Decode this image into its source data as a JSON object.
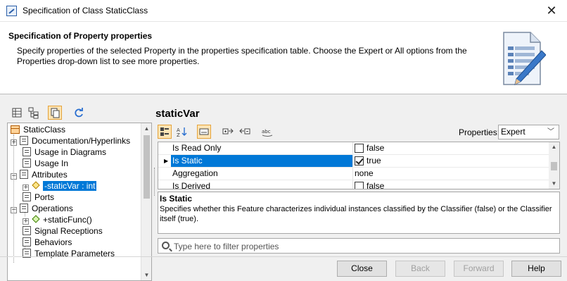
{
  "window": {
    "title": "Specification of Class StaticClass",
    "close_glyph": "✕"
  },
  "header": {
    "title": "Specification of Property properties",
    "description": "Specify properties of the selected Property in the properties specification table. Choose the Expert or All options from the Properties drop-down list to see more properties.",
    "icon": "document-pencil-icon"
  },
  "left_toolbar": {
    "buttons": [
      {
        "name": "list-view-icon"
      },
      {
        "name": "tree-view-icon"
      },
      {
        "name": "copy-icon",
        "active": true
      },
      {
        "name": "refresh-icon"
      }
    ]
  },
  "tree": {
    "root": "StaticClass",
    "items": [
      {
        "label": "Documentation/Hyperlinks"
      },
      {
        "label": "Usage in Diagrams"
      },
      {
        "label": "Usage In"
      },
      {
        "label": "Attributes"
      },
      {
        "label": "-staticVar : int",
        "selected": true
      },
      {
        "label": "Ports"
      },
      {
        "label": "Operations"
      },
      {
        "label": "+staticFunc()"
      },
      {
        "label": "Signal Receptions"
      },
      {
        "label": "Behaviors"
      },
      {
        "label": "Template Parameters"
      }
    ]
  },
  "right": {
    "title": "staticVar",
    "properties_label": "Properties:",
    "properties_value": "Expert",
    "rows": [
      {
        "name": "Is Read Only",
        "value": "false",
        "checkbox": true,
        "checked": false
      },
      {
        "name": "Is Static",
        "value": "true",
        "checkbox": true,
        "checked": true,
        "selected": true
      },
      {
        "name": "Aggregation",
        "value": "none",
        "checkbox": false
      },
      {
        "name": "Is Derived",
        "value": "false",
        "checkbox": true,
        "checked": false
      }
    ],
    "description": {
      "title": "Is Static",
      "text": "Specifies whether this Feature characterizes individual instances classified by the Classifier (false) or the Classifier itself (true)."
    },
    "filter_placeholder": "Type here to filter properties"
  },
  "buttons": {
    "close": "Close",
    "back": "Back",
    "forward": "Forward",
    "help": "Help"
  }
}
